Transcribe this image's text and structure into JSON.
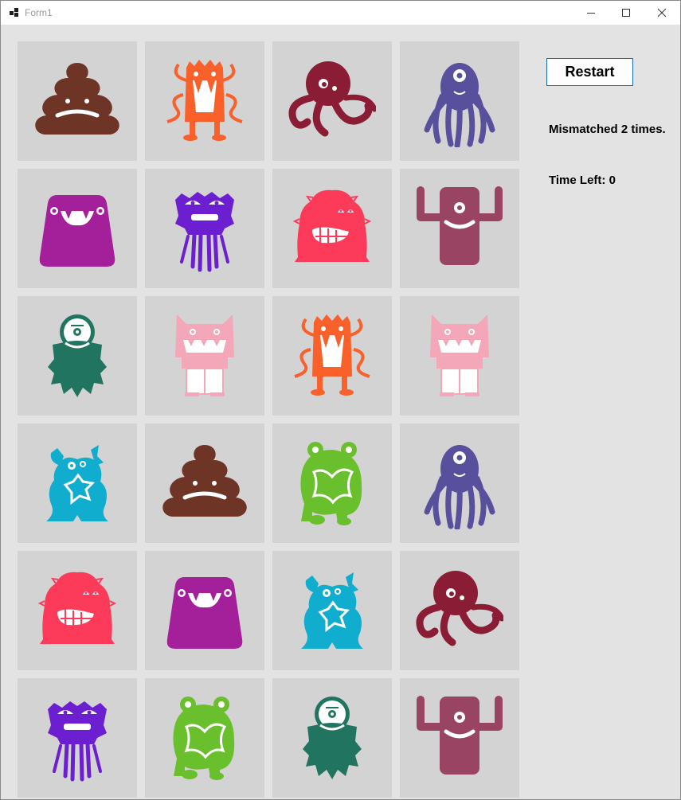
{
  "window": {
    "title": "Form1"
  },
  "controls": {
    "restart_label": "Restart"
  },
  "status": {
    "mismatch": "Mismatched 2 times.",
    "time_left": "Time Left: 0"
  },
  "colors": {
    "card_bg": "#d3d3d3",
    "form_bg": "#e3e3e3",
    "poop": "#6e3425",
    "orange": "#f9602a",
    "octopus": "#8b1c35",
    "blue_alien": "#58509c",
    "magenta": "#a4209a",
    "purple": "#6c1fd0",
    "red_fuzzy": "#fb3b59",
    "mauve": "#9a4464",
    "green_beard": "#217460",
    "pink": "#f4a7b9",
    "cyan": "#11adce",
    "lime": "#6abf2d"
  },
  "board": {
    "rows": [
      [
        "poop-monster",
        "orange-tentacle-monster",
        "octopus-monster",
        "one-eyed-tentacle-monster"
      ],
      [
        "magenta-blob-monster",
        "purple-stick-monster",
        "red-fuzzy-monster",
        "mauve-cyclops-monster"
      ],
      [
        "green-bearded-monster",
        "pink-cat-monster",
        "orange-tentacle-monster",
        "pink-cat-monster"
      ],
      [
        "cyan-star-monster",
        "poop-monster",
        "green-frog-monster",
        "one-eyed-tentacle-monster"
      ],
      [
        "red-fuzzy-monster",
        "magenta-blob-monster",
        "cyan-star-monster",
        "octopus-monster"
      ],
      [
        "purple-stick-monster",
        "green-frog-monster",
        "green-bearded-monster",
        "mauve-cyclops-monster"
      ]
    ]
  }
}
